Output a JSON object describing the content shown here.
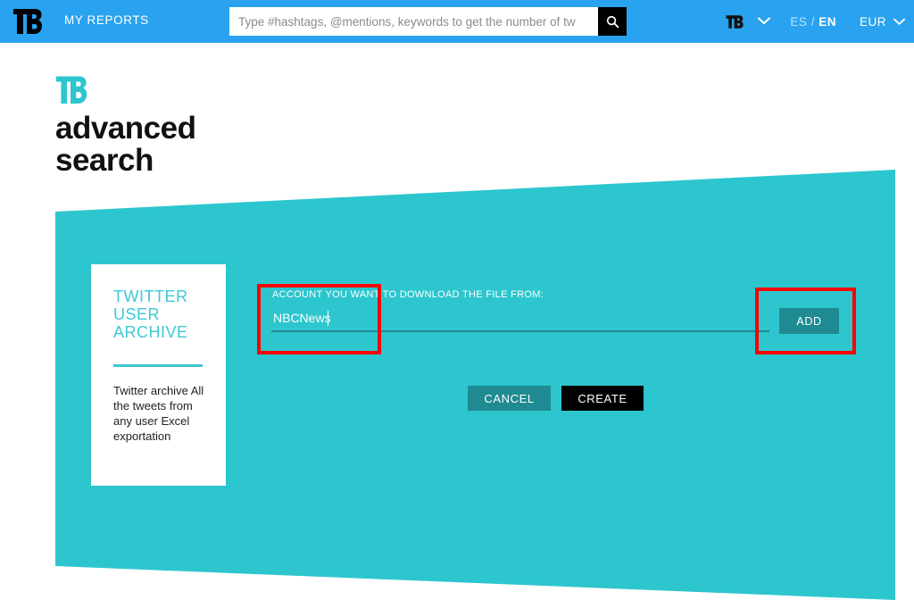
{
  "header": {
    "brand_logo_icon": "tb-logo-icon",
    "nav_my_reports": "MY REPORTS",
    "search": {
      "placeholder": "Type #hashtags, @mentions, keywords to get the number of tw",
      "value": "",
      "button_icon": "search-icon"
    },
    "account_logo_icon": "tb-logo-small-icon",
    "account_chevron_icon": "chevron-down-icon",
    "language": {
      "inactive": "ES",
      "separator": "/",
      "active": "EN"
    },
    "currency": {
      "label": "EUR",
      "chevron_icon": "chevron-down-icon"
    }
  },
  "page_logo": {
    "mark_icon": "tb-logo-teal-icon",
    "line1": "advanced",
    "line2": "search"
  },
  "card": {
    "title": "TWITTER USER ARCHIVE",
    "description": "Twitter archive All the tweets from any user Excel exportation"
  },
  "form": {
    "label": "ACCOUNT YOU WANT TO DOWNLOAD THE FILE FROM:",
    "account_value": "NBCNews",
    "account_placeholder": "",
    "add_label": "ADD",
    "cancel_label": "CANCEL",
    "create_label": "CREATE"
  },
  "colors": {
    "header_blue": "#29a3ef",
    "teal": "#2dc6ce",
    "teal_dark": "#1f8a91",
    "card_accent": "#3ec8d4",
    "black": "#000000",
    "annotation_red": "#ff0000"
  }
}
